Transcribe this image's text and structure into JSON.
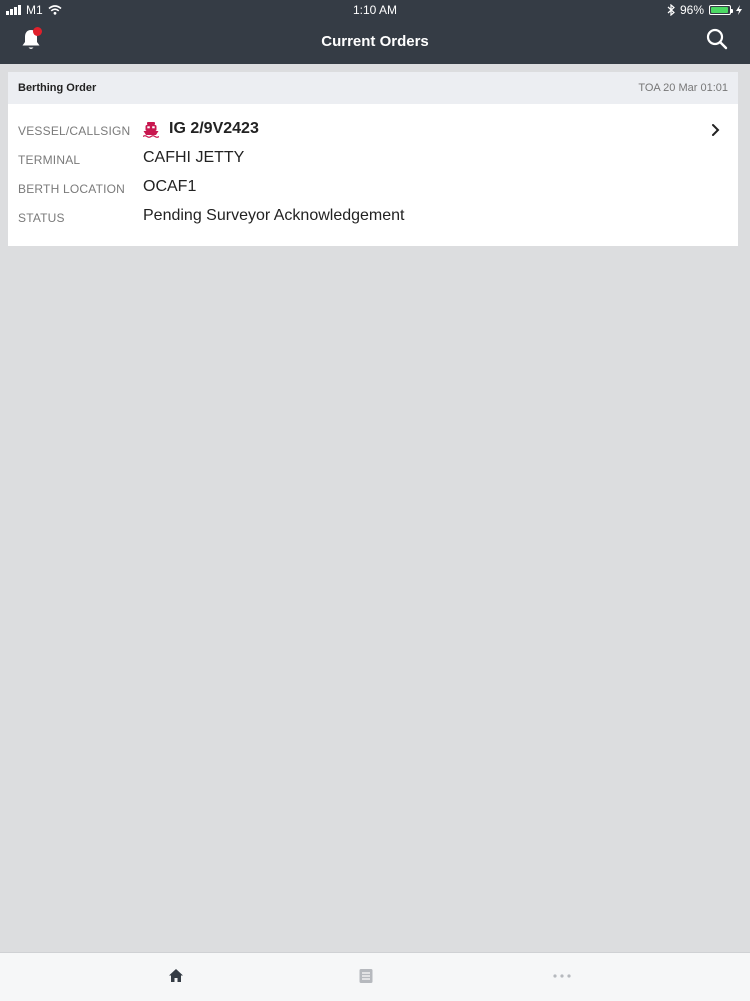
{
  "status_bar": {
    "carrier": "M1",
    "time": "1:10 AM",
    "battery": "96%",
    "battery_level": 0.96
  },
  "header": {
    "title": "Current Orders",
    "icons": [
      "bell-icon",
      "search-icon"
    ],
    "notification_indicator_color": "#e0202b"
  },
  "card": {
    "title": "Berthing Order",
    "date": "TOA 20 Mar 01:01",
    "rows": [
      {
        "label": "VESSEL/CALLSIGN",
        "value": "IG 2/9V2423"
      },
      {
        "label": "TERMINAL",
        "value": "CAFHI JETTY"
      },
      {
        "label": "BERTH LOCATION",
        "value": "OCAF1"
      },
      {
        "label": "STATUS",
        "value": "Pending Surveyor Acknowledgement"
      }
    ],
    "vessel_icon": "ship-icon",
    "vessel_icon_color": "#c8174f"
  },
  "tabbar": {
    "tabs": [
      "home-icon",
      "list-icon",
      "more-icon"
    ],
    "active": "home-icon"
  },
  "colors": {
    "header_bg": "#353c45",
    "page_bg": "#dcdddf",
    "card_header_bg": "#eceef2"
  }
}
